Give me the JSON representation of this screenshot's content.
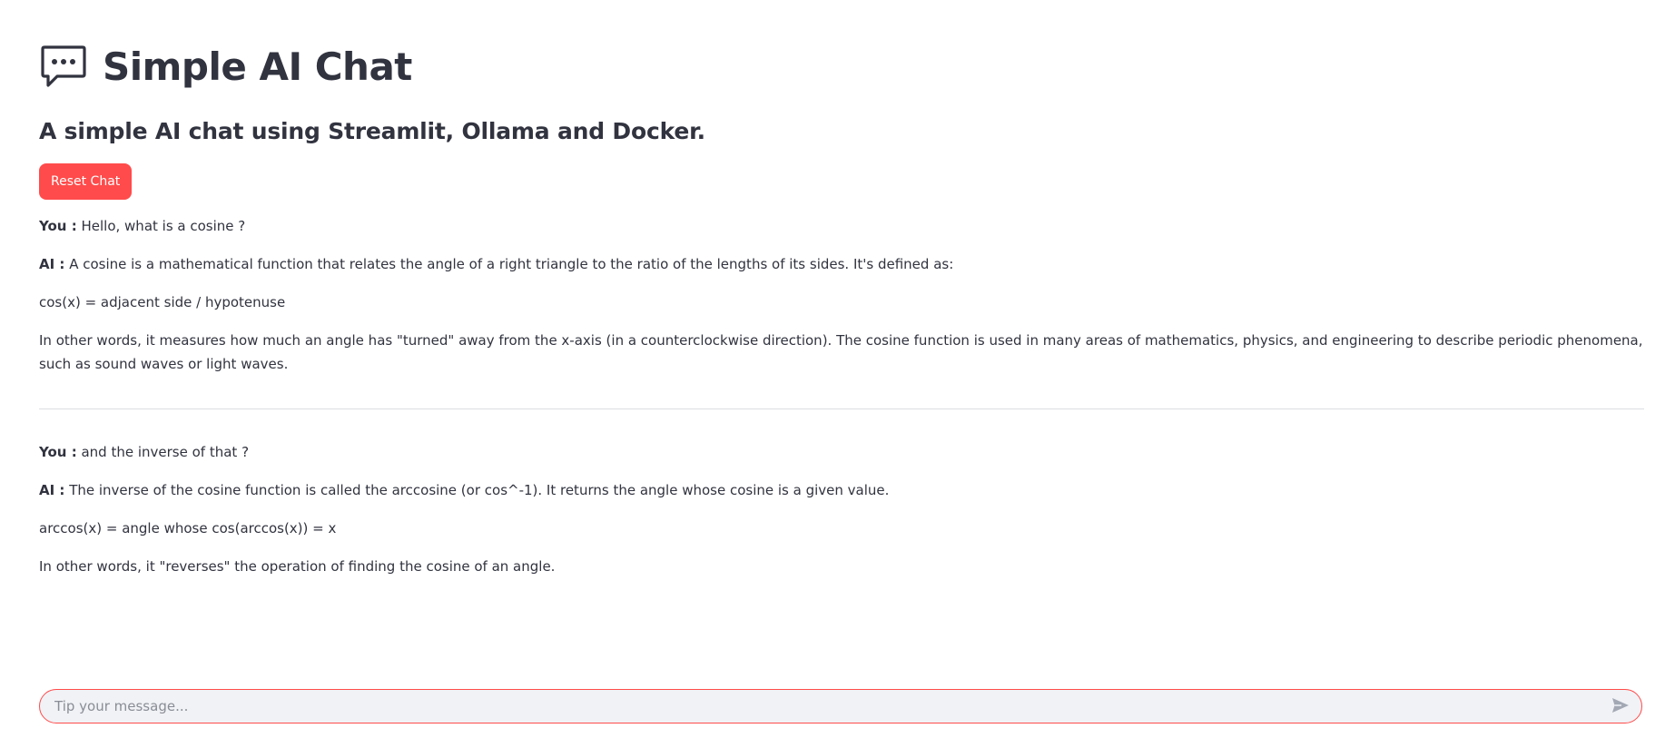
{
  "header": {
    "title": "Simple AI Chat",
    "icon": "speech-bubble-icon"
  },
  "subtitle": "A simple AI chat using Streamlit, Ollama and Docker.",
  "reset_button": {
    "label": "Reset Chat"
  },
  "conversation": [
    {
      "user_prefix": "You :",
      "user_message": "Hello, what is a cosine ?",
      "ai_prefix": "AI :",
      "ai_first": "A cosine is a mathematical function that relates the angle of a right triangle to the ratio of the lengths of its sides. It's defined as:",
      "ai_paragraphs": [
        "cos(x) = adjacent side / hypotenuse",
        "In other words, it measures how much an angle has \"turned\" away from the x-axis (in a counterclockwise direction). The cosine function is used in many areas of mathematics, physics, and engineering to describe periodic phenomena, such as sound waves or light waves."
      ]
    },
    {
      "user_prefix": "You :",
      "user_message": "and the inverse of that ?",
      "ai_prefix": "AI :",
      "ai_first": "The inverse of the cosine function is called the arccosine (or cos^-1). It returns the angle whose cosine is a given value.",
      "ai_paragraphs": [
        "arccos(x) = angle whose cos(arccos(x)) = x",
        "In other words, it \"reverses\" the operation of finding the cosine of an angle."
      ]
    }
  ],
  "chat_input": {
    "placeholder": "Tip your message...",
    "value": "",
    "send_icon": "send-icon"
  },
  "colors": {
    "accent": "#ff4b4b",
    "text": "#31333f",
    "input_bg": "#f0f2f6",
    "divider": "#dcdde1"
  }
}
